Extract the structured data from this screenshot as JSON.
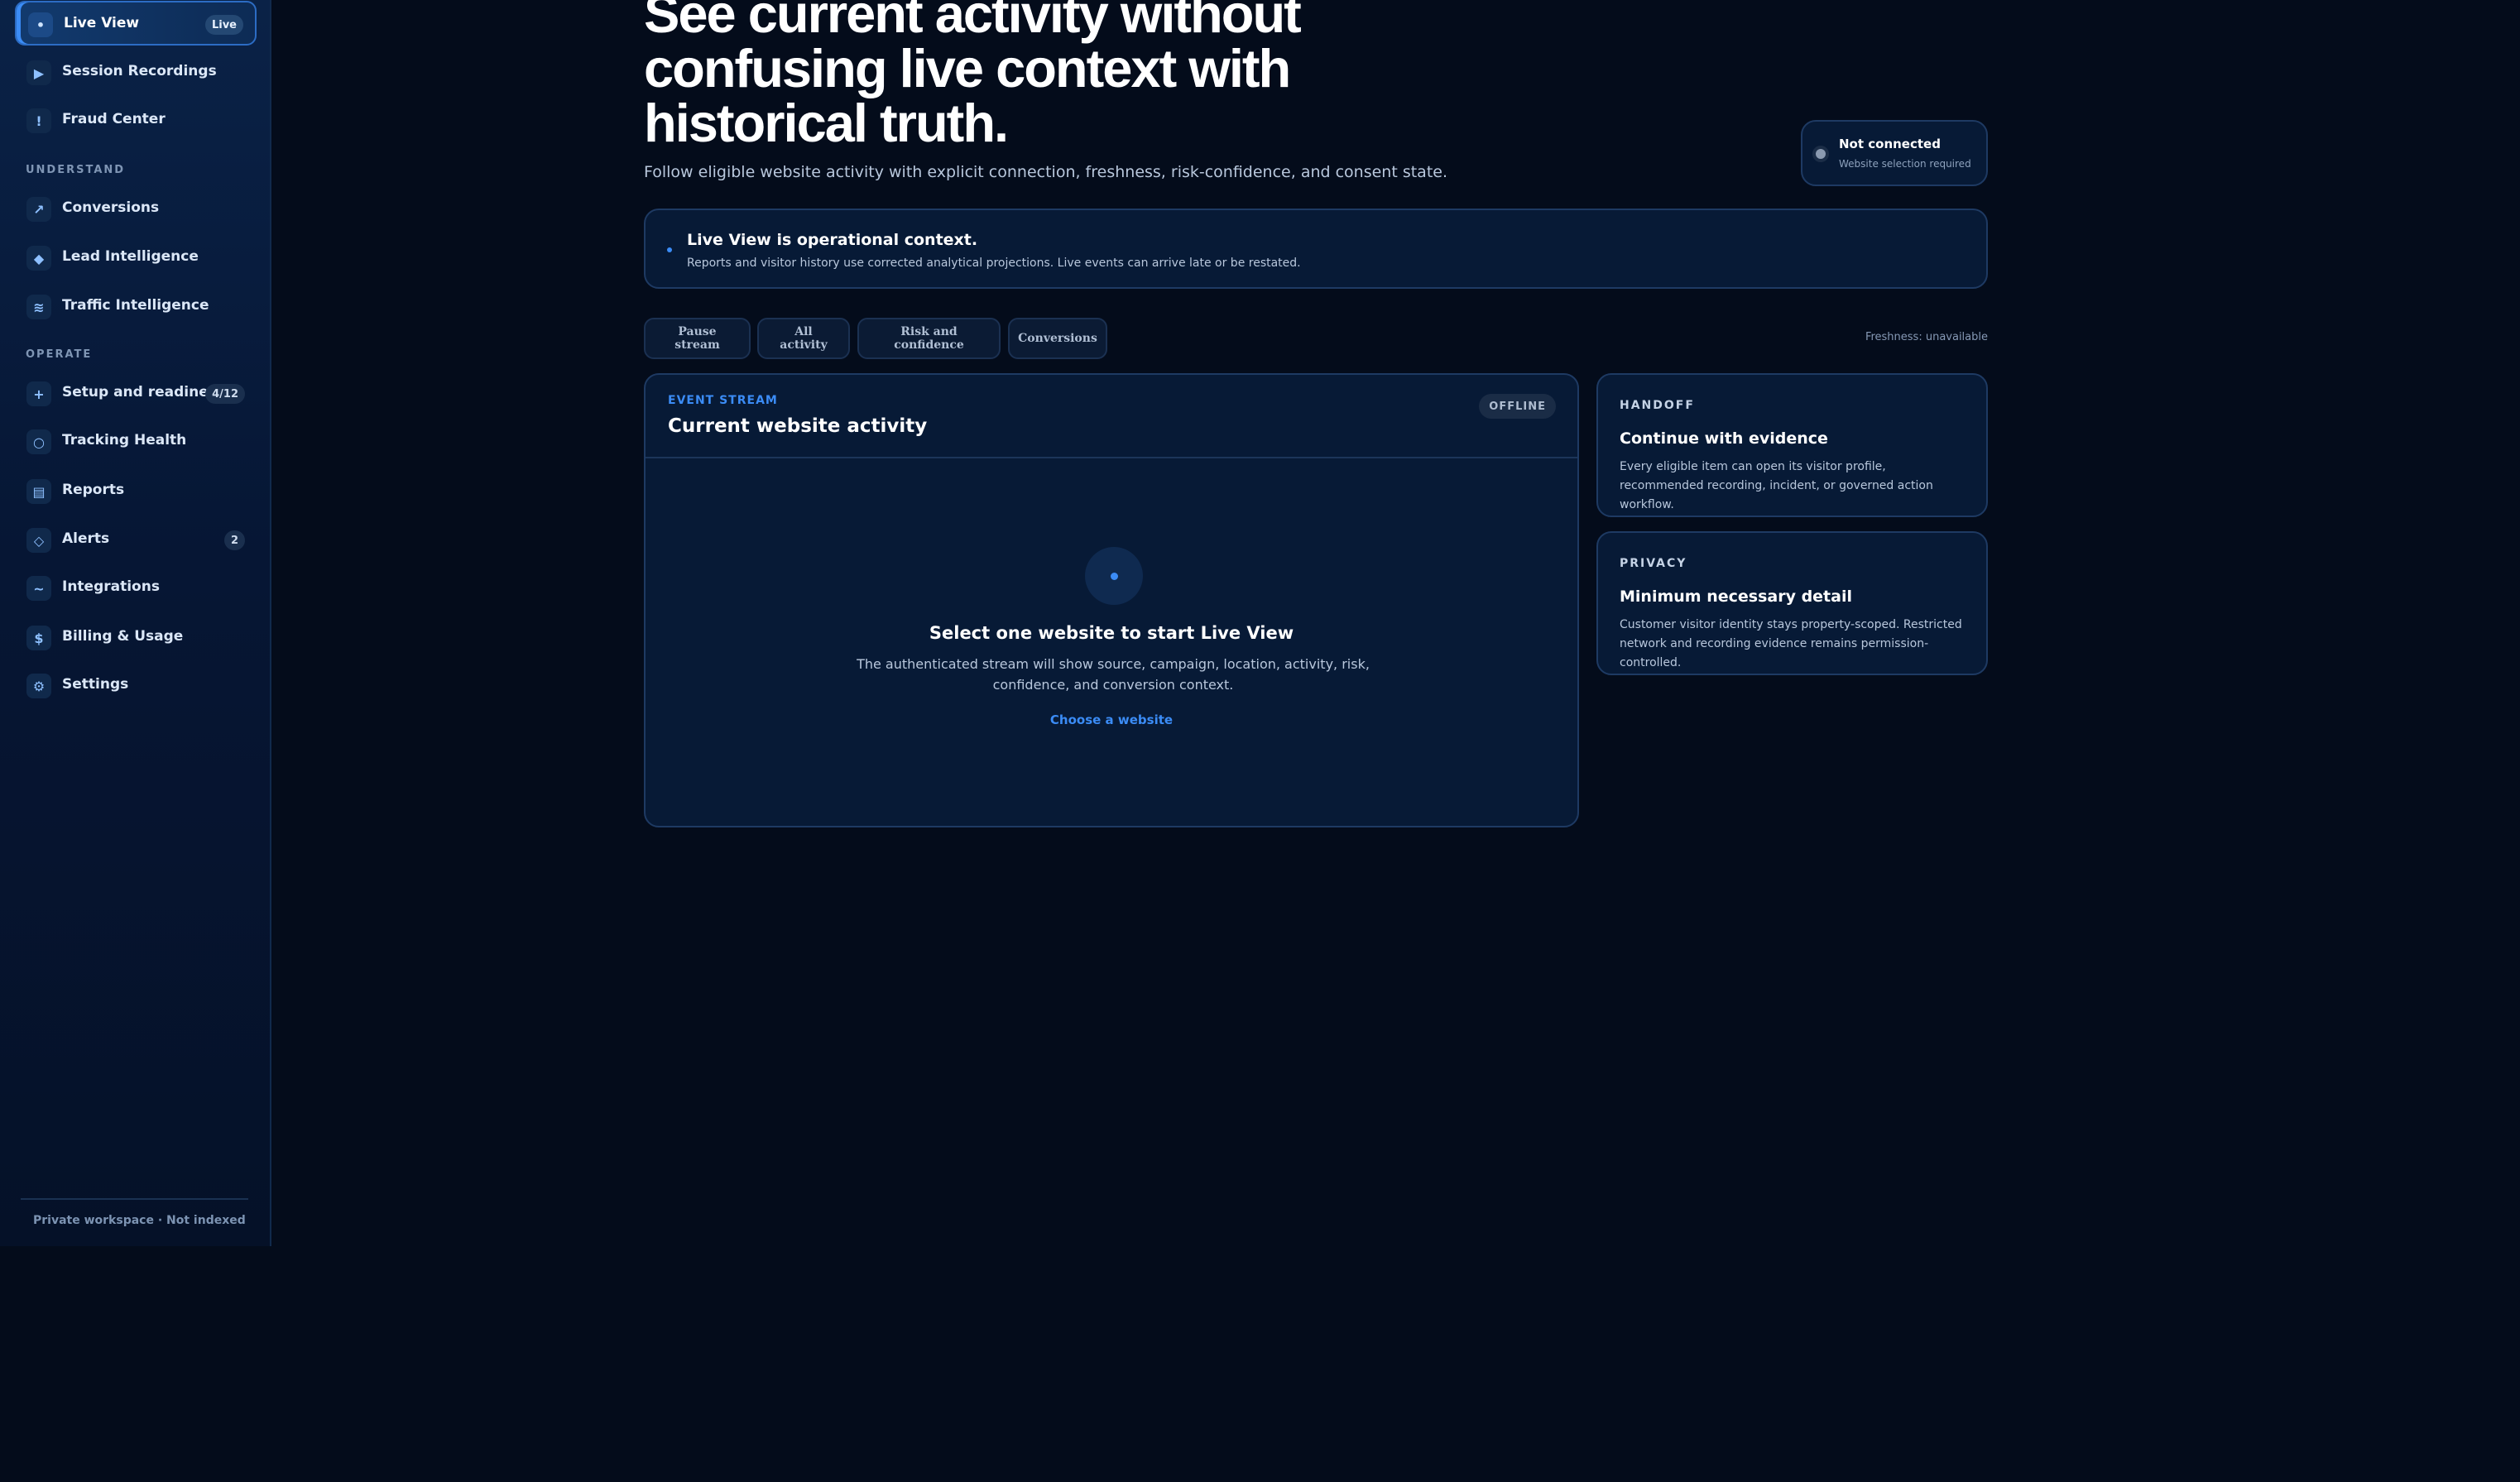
{
  "sidebar": {
    "items_top": [
      {
        "label": "Live View",
        "icon": "•",
        "badge": "Live"
      },
      {
        "label": "Session Recordings",
        "icon": "▶",
        "badge": ""
      },
      {
        "label": "Fraud Center",
        "icon": "!",
        "badge": ""
      }
    ],
    "section_understand": "UNDERSTAND",
    "items_understand": [
      {
        "label": "Conversions",
        "icon": "↗",
        "badge": ""
      },
      {
        "label": "Lead Intelligence",
        "icon": "◆",
        "badge": ""
      },
      {
        "label": "Traffic Intelligence",
        "icon": "≋",
        "badge": ""
      }
    ],
    "section_operate": "OPERATE",
    "items_operate": [
      {
        "label": "Setup and readiness",
        "icon": "+",
        "badge": "4/12"
      },
      {
        "label": "Tracking Health",
        "icon": "○",
        "badge": ""
      },
      {
        "label": "Reports",
        "icon": "▤",
        "badge": ""
      },
      {
        "label": "Alerts",
        "icon": "◇",
        "badge": "2"
      },
      {
        "label": "Integrations",
        "icon": "~",
        "badge": ""
      },
      {
        "label": "Billing & Usage",
        "icon": "$",
        "badge": ""
      },
      {
        "label": "Settings",
        "icon": "⚙",
        "badge": ""
      }
    ],
    "footer": "Private workspace · Not indexed"
  },
  "header": {
    "title": "See current activity without confusing live context with historical truth.",
    "subtitle": "Follow eligible website activity with explicit connection, freshness, risk-confidence, and consent state."
  },
  "connection": {
    "title": "Not connected",
    "subtitle": "Website selection required"
  },
  "banner": {
    "title": "Live View is operational context.",
    "body": "Reports and visitor history use corrected analytical projections. Live events can arrive late or be restated."
  },
  "filters": [
    "Pause stream",
    "All activity",
    "Risk and confidence",
    "Conversions"
  ],
  "freshness": "Freshness: unavailable",
  "stream": {
    "eyebrow": "EVENT STREAM",
    "title": "Current website activity",
    "status": "OFFLINE",
    "empty_title": "Select one website to start Live View",
    "empty_body": "The authenticated stream will show source, campaign, location, activity, risk, confidence, and conversion context.",
    "empty_link": "Choose a website"
  },
  "handoff": {
    "eyebrow": "HANDOFF",
    "title": "Continue with evidence",
    "body": "Every eligible item can open its visitor profile, recommended recording, incident, or governed action workflow."
  },
  "privacy": {
    "eyebrow": "PRIVACY",
    "title": "Minimum necessary detail",
    "body": "Customer visitor identity stays property-scoped. Restricted network and recording evidence remains permission-controlled."
  }
}
